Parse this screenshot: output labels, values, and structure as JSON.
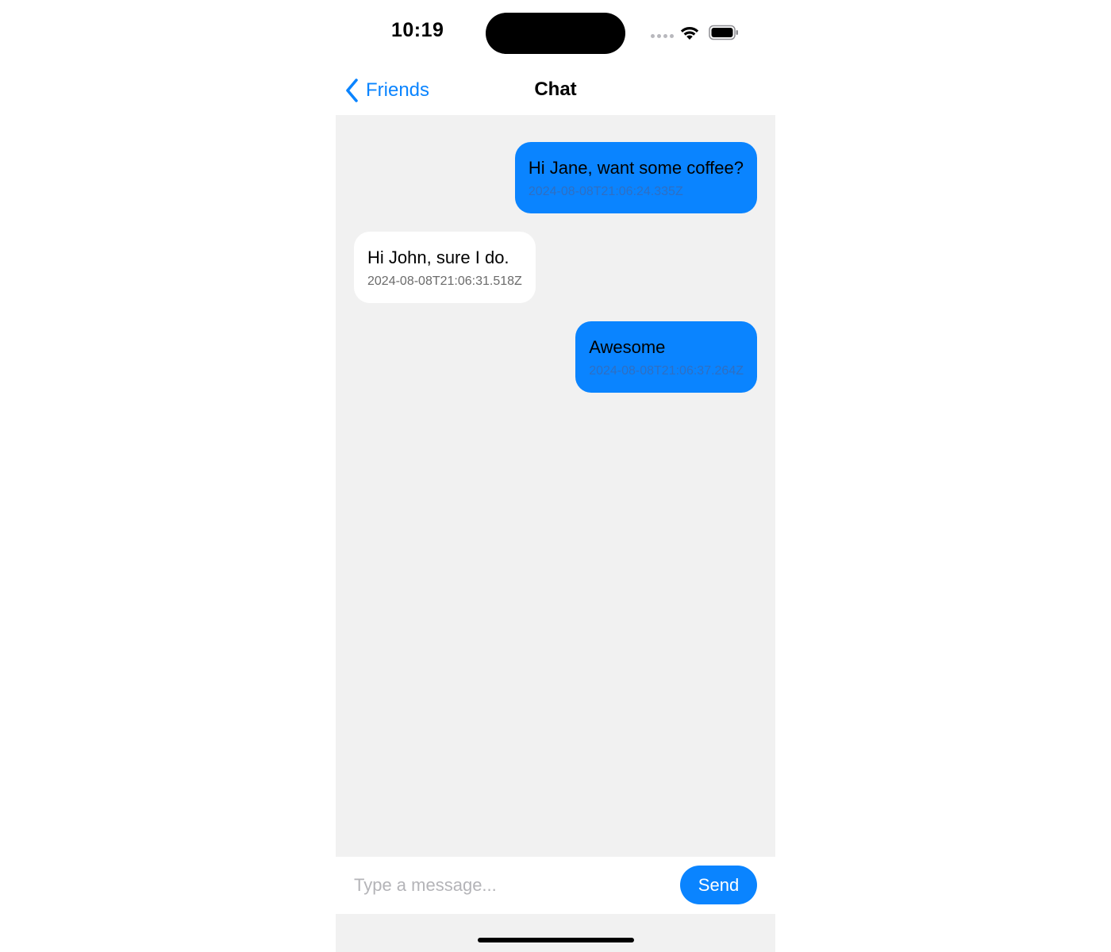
{
  "status_bar": {
    "time": "10:19",
    "icons": [
      "cellular-signal-icon",
      "wifi-icon",
      "battery-icon"
    ]
  },
  "nav": {
    "back_label": "Friends",
    "title": "Chat"
  },
  "messages": [
    {
      "direction": "outgoing",
      "text": "Hi Jane, want some coffee?",
      "timestamp": "2024-08-08T21:06:24.335Z"
    },
    {
      "direction": "incoming",
      "text": "Hi John, sure I do.",
      "timestamp": "2024-08-08T21:06:31.518Z"
    },
    {
      "direction": "outgoing",
      "text": "Awesome",
      "timestamp": "2024-08-08T21:06:37.264Z"
    }
  ],
  "composer": {
    "placeholder": "Type a message...",
    "value": "",
    "send_label": "Send"
  },
  "colors": {
    "accent": "#0a84ff",
    "chat_background": "#f1f1f1",
    "incoming_bubble": "#ffffff",
    "outgoing_bubble": "#0a84ff"
  }
}
